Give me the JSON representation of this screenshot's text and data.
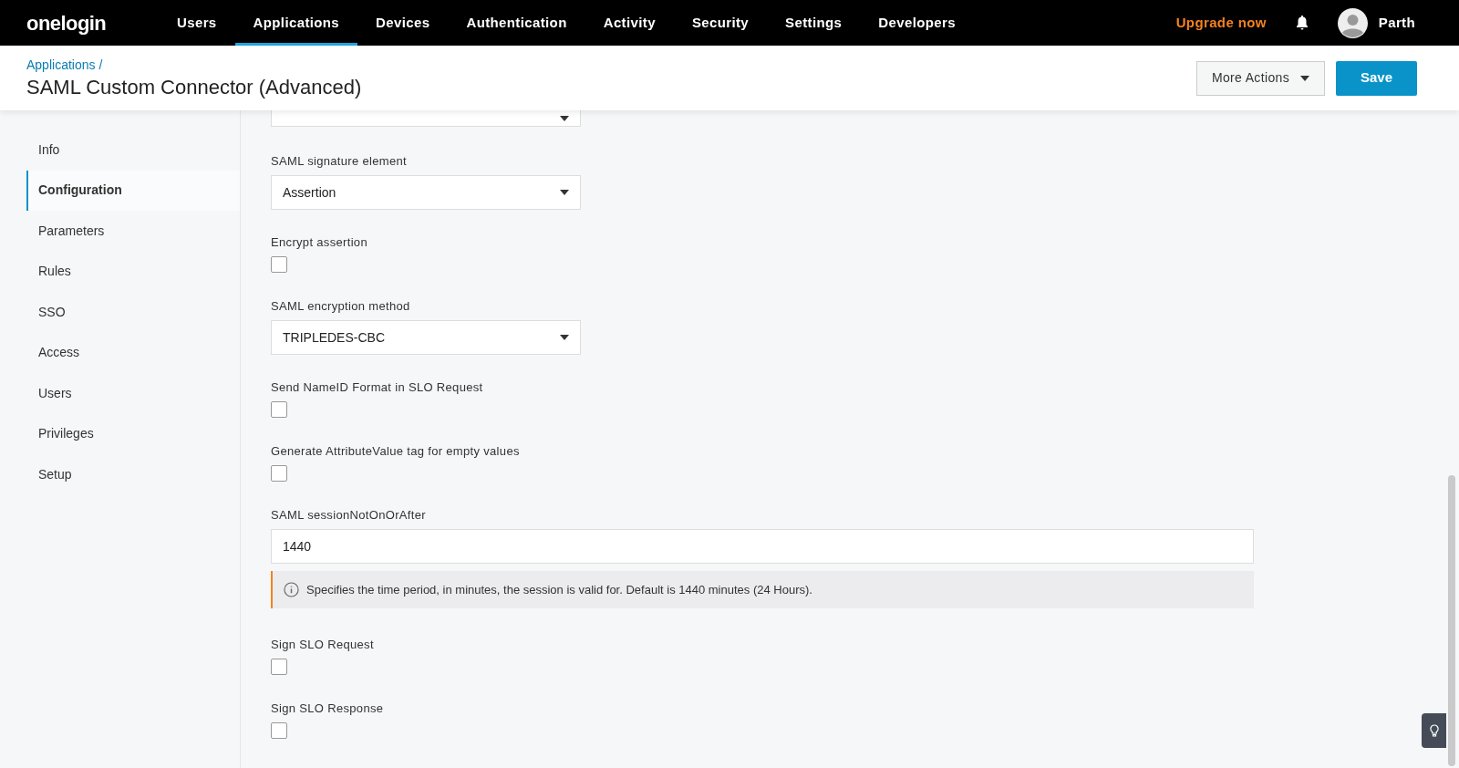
{
  "nav": {
    "logo": "onelogin",
    "items": [
      {
        "label": "Users",
        "selected": false
      },
      {
        "label": "Applications",
        "selected": true
      },
      {
        "label": "Devices",
        "selected": false
      },
      {
        "label": "Authentication",
        "selected": false
      },
      {
        "label": "Activity",
        "selected": false
      },
      {
        "label": "Security",
        "selected": false
      },
      {
        "label": "Settings",
        "selected": false
      },
      {
        "label": "Developers",
        "selected": false
      }
    ],
    "upgrade": "Upgrade now",
    "user": "Parth"
  },
  "header": {
    "breadcrumb": "Applications /",
    "title": "SAML Custom Connector (Advanced)",
    "buttons": [
      "More Actions",
      "Save"
    ]
  },
  "sidebar": {
    "items": [
      {
        "label": "Info",
        "selected": false
      },
      {
        "label": "Configuration",
        "selected": true
      },
      {
        "label": "Parameters",
        "selected": false
      },
      {
        "label": "Rules",
        "selected": false
      },
      {
        "label": "SSO",
        "selected": false
      },
      {
        "label": "Access",
        "selected": false
      },
      {
        "label": "Users",
        "selected": false
      },
      {
        "label": "Privileges",
        "selected": false
      },
      {
        "label": "Setup",
        "selected": false
      }
    ]
  },
  "fields": [
    {
      "kind": "select",
      "label": "SAML signature element",
      "value": "Assertion"
    },
    {
      "kind": "checkbox",
      "label": "Encrypt assertion",
      "checked": false
    },
    {
      "kind": "select",
      "label": "SAML encryption method",
      "value": "TRIPLEDES-CBC"
    },
    {
      "kind": "checkbox",
      "label": "Send NameID Format in SLO Request",
      "checked": false
    },
    {
      "kind": "checkbox",
      "label": "Generate AttributeValue tag for empty values",
      "checked": false
    },
    {
      "kind": "text",
      "label": "SAML sessionNotOnOrAfter",
      "value": "1440",
      "note": "Specifies the time period, in minutes, the session is valid for. Default is 1440 minutes (24 Hours)."
    },
    {
      "kind": "checkbox",
      "label": "Sign SLO Request",
      "checked": false
    },
    {
      "kind": "checkbox",
      "label": "Sign SLO Response",
      "checked": false
    }
  ]
}
